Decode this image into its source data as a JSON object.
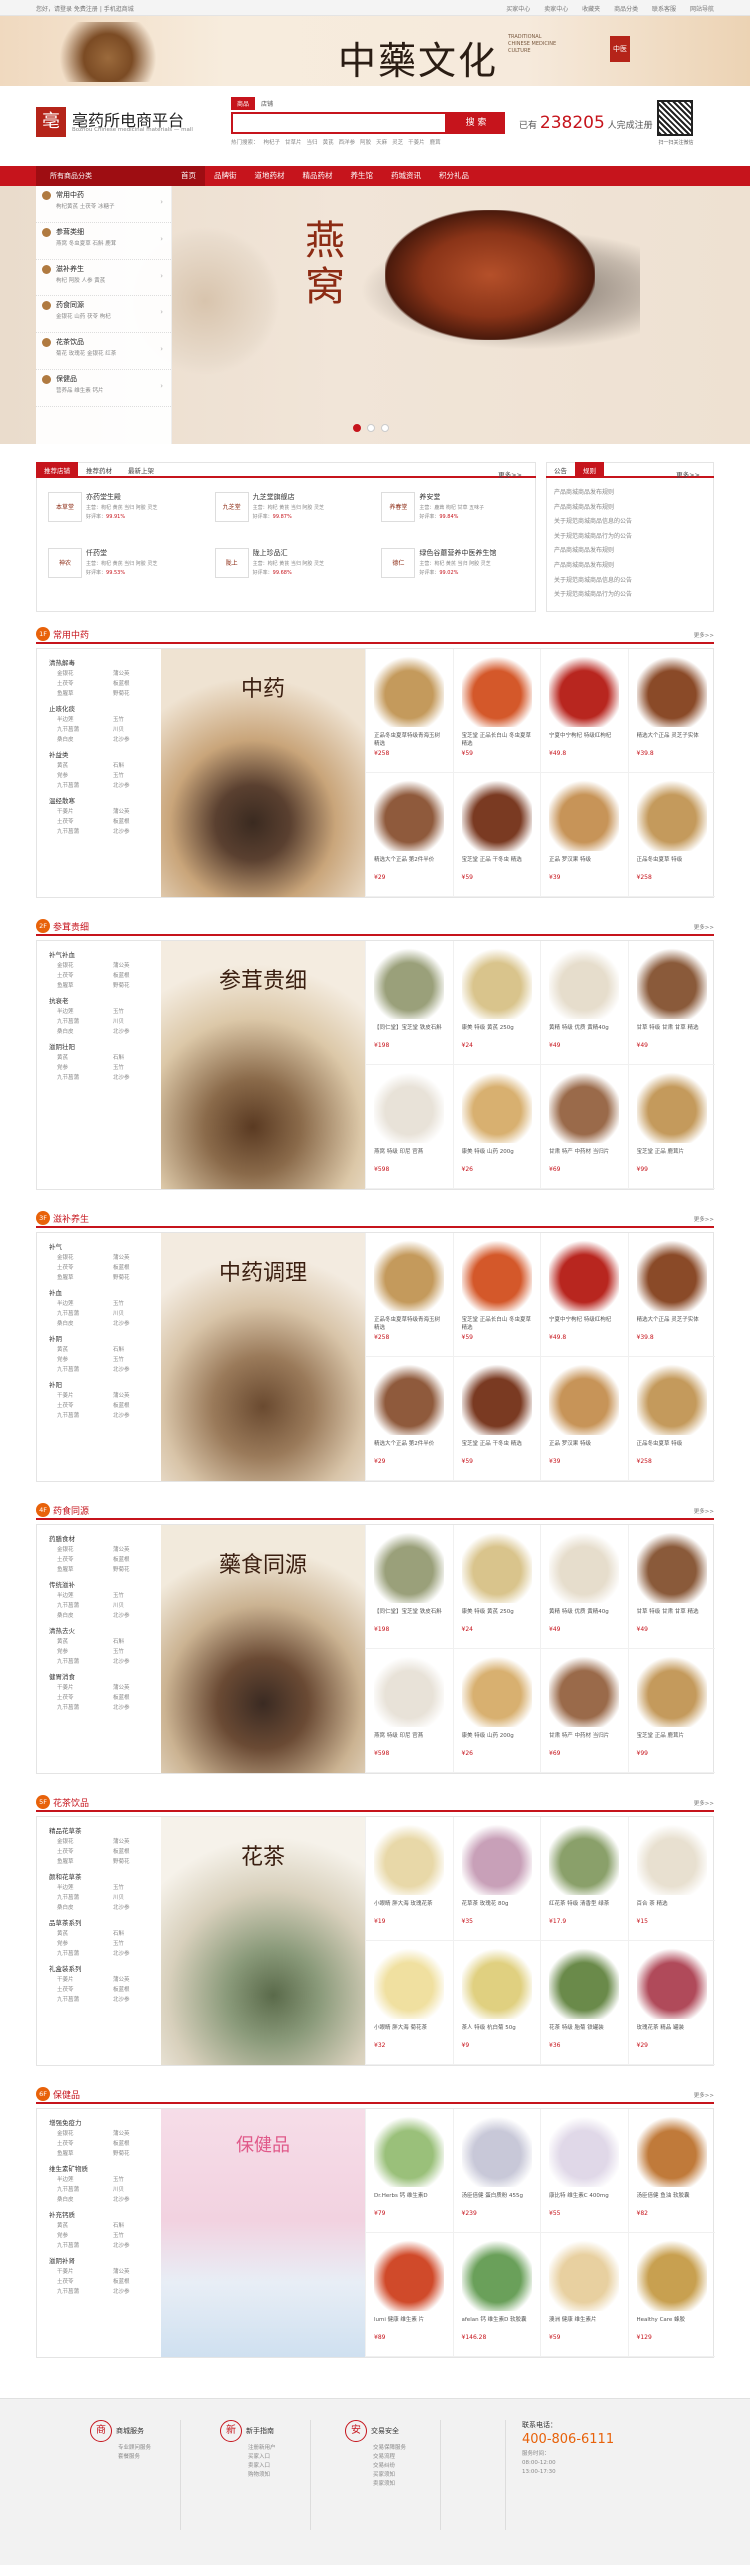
{
  "topbar": {
    "left": "您好，请登录 免费注册 | 手机逛商城",
    "links": [
      "买家中心",
      "卖家中心",
      "收藏夹",
      "商品分类",
      "联系客服",
      "网站导航"
    ]
  },
  "banner": {
    "title": "中藥文化",
    "seal": "中医",
    "sub": "TRADITIONAL CHINESE MEDICINE CULTURE"
  },
  "logo": {
    "mark": "亳",
    "name": "亳药所电商平台",
    "en": "Bozhou Chinese medicinal materials — mall"
  },
  "search": {
    "tabs": [
      "商品",
      "店铺"
    ],
    "placeholder": "",
    "button": "搜 索",
    "hot_label": "热门搜索：",
    "hot": [
      "枸杞子",
      "甘草片",
      "当归",
      "黄芪",
      "西洋参",
      "阿胶",
      "天麻",
      "灵芝",
      "干姜片",
      "鹿茸"
    ]
  },
  "joined": {
    "prefix": "已有",
    "count": "238205",
    "suffix": "人完成注册"
  },
  "qr_label": "扫一扫关注微信",
  "nav": {
    "all": "所有商品分类",
    "items": [
      "首页",
      "品牌街",
      "道地药材",
      "精品药材",
      "养生馆",
      "药城资讯",
      "积分礼品"
    ]
  },
  "categories": [
    {
      "t": "常用中药",
      "s": "枸杞黄芪  土茯苓  冰糖子"
    },
    {
      "t": "参茸类细",
      "s": "燕窝  冬虫夏草  石斛  鹿茸"
    },
    {
      "t": "滋补养生",
      "s": "枸杞  阿胶  人参  黄芪"
    },
    {
      "t": "药食同源",
      "s": "金银花  山药  茯苓  枸杞"
    },
    {
      "t": "花茶饮品",
      "s": "菊花  玫瑰花  金银花  红茶"
    },
    {
      "t": "保健品",
      "s": "营养品  维生素  钙片"
    }
  ],
  "hero": {
    "title": "燕窝"
  },
  "shops": {
    "tabs": [
      "推荐店铺",
      "推荐药材",
      "最新上架"
    ],
    "more": "更多>>",
    "items": [
      {
        "logo": "本草堂",
        "name": "亦药堂生殿",
        "desc": "主营：枸杞  黄芪  当归  阿胶 灵芝",
        "good": "99.91%"
      },
      {
        "logo": "九芝堂",
        "name": "九芝堂旗舰店",
        "desc": "主营：枸杞  黄芪  当归  阿胶 灵芝",
        "good": "99.87%"
      },
      {
        "logo": "养春堂",
        "name": "养安堂",
        "desc": "主营：鹿茸  枸杞  甘草  五味子",
        "good": "99.84%"
      },
      {
        "logo": "神农",
        "name": "仟药堂",
        "desc": "主营：枸杞  黄芪  当归  阿胶 灵芝",
        "good": "99.53%"
      },
      {
        "logo": "陇上",
        "name": "陇上珍品汇",
        "desc": "主营：枸杞  黄芪  当归  阿胶 灵芝",
        "good": "99.68%"
      },
      {
        "logo": "德仁",
        "name": "绿色谷蘑营养中医养生馆",
        "desc": "主营：枸杞  黄芪  当归  阿胶 灵芝",
        "good": "99.02%"
      }
    ],
    "good_label": "好评率："
  },
  "notice": {
    "tabs": [
      "公告",
      "规则"
    ],
    "more": "更多>>",
    "items": [
      "产品商城商品发布规则",
      "产品商城商品发布规则",
      "关于规范商城商品信息的公告",
      "关于规范商城商品行为的公告",
      "产品商城商品发布规则",
      "产品商城商品发布规则",
      "关于规范商城商品信息的公告",
      "关于规范商城商品行为的公告"
    ]
  },
  "floors": [
    {
      "num": "1F",
      "title": "常用中药",
      "more": "更多>>",
      "ad": "中药",
      "groups": [
        {
          "h": "清热解毒",
          "l": [
            "金银花",
            "蒲公英",
            "土茯苓",
            "板蓝根",
            "鱼腥草",
            "野菊花"
          ]
        },
        {
          "h": "止咳化痰",
          "l": [
            "半边莲",
            "玉竹",
            "九节菖蒲",
            "川贝",
            "桑白皮",
            "北沙参"
          ]
        },
        {
          "h": "补益类",
          "l": [
            "黄芪",
            "石斛",
            "党参",
            "玉竹",
            "九节菖蒲",
            "北沙参"
          ]
        },
        {
          "h": "温经散寒",
          "l": [
            "干姜片",
            "蒲公英",
            "土茯苓",
            "板蓝根",
            "九节菖蒲",
            "北沙参"
          ]
        }
      ],
      "prods": [
        {
          "n": "正品冬虫夏草特级青海玉树精选",
          "p": "¥258",
          "c": "#c49a5c"
        },
        {
          "n": "宝芝堂 正品长白山 冬虫夏草 精选",
          "p": "¥59",
          "c": "#d4582a"
        },
        {
          "n": "宁夏中宁枸杞 特级红枸杞",
          "p": "¥49.8",
          "c": "#b8261f"
        },
        {
          "n": "精选大个正品 灵芝子实体",
          "p": "¥39.8",
          "c": "#8a4a28"
        },
        {
          "n": "精选大个正品 第2件半价",
          "p": "¥29",
          "c": "#8f5a3c"
        },
        {
          "n": "宝芝堂 正品 干冬虫 精选",
          "p": "¥59",
          "c": "#7a3a22"
        },
        {
          "n": "正品 罗汉果 特级",
          "p": "¥39",
          "c": "#c79458"
        },
        {
          "n": "正品冬虫夏草 特级",
          "p": "¥258",
          "c": "#c49a5c"
        }
      ]
    },
    {
      "num": "2F",
      "title": "参茸贵细",
      "more": "更多>>",
      "ad": "参茸贵细",
      "groups": [
        {
          "h": "补气补血",
          "l": [
            "金银花",
            "蒲公英",
            "土茯苓",
            "板蓝根",
            "鱼腥草",
            "野菊花"
          ]
        },
        {
          "h": "抗衰老",
          "l": [
            "半边莲",
            "玉竹",
            "九节菖蒲",
            "川贝",
            "桑白皮",
            "北沙参"
          ]
        },
        {
          "h": "滋阴壮阳",
          "l": [
            "黄芪",
            "石斛",
            "党参",
            "玉竹",
            "九节菖蒲",
            "北沙参"
          ]
        }
      ],
      "prods": [
        {
          "n": "【同仁堂】宝芝堂 铁皮石斛",
          "p": "¥198",
          "c": "#9aa07a"
        },
        {
          "n": "康美 特级 黄芪 250g",
          "p": "¥24",
          "c": "#d9c48c"
        },
        {
          "n": "黄精 特级 优质 黄精40g",
          "p": "¥49",
          "c": "#e6ddcc"
        },
        {
          "n": "甘草 特级 甘肃 甘草 精选",
          "p": "¥49",
          "c": "#8a5a3a"
        },
        {
          "n": "燕窝 特级 印尼 官燕",
          "p": "¥598",
          "c": "#e8e2d8"
        },
        {
          "n": "康美 特级 山药 200g",
          "p": "¥26",
          "c": "#d8b070"
        },
        {
          "n": "甘肃 特产 中药材 当归片",
          "p": "¥69",
          "c": "#9a6a4a"
        },
        {
          "n": "宝芝堂 正品 鹿茸片",
          "p": "¥99",
          "c": "#c49a5c"
        }
      ]
    },
    {
      "num": "3F",
      "title": "滋补养生",
      "more": "更多>>",
      "ad": "中药调理",
      "groups": [
        {
          "h": "补气",
          "l": [
            "金银花",
            "蒲公英",
            "土茯苓",
            "板蓝根",
            "鱼腥草",
            "野菊花"
          ]
        },
        {
          "h": "补血",
          "l": [
            "半边莲",
            "玉竹",
            "九节菖蒲",
            "川贝",
            "桑白皮",
            "北沙参"
          ]
        },
        {
          "h": "补阴",
          "l": [
            "黄芪",
            "石斛",
            "党参",
            "玉竹",
            "九节菖蒲",
            "北沙参"
          ]
        },
        {
          "h": "补阳",
          "l": [
            "干姜片",
            "蒲公英",
            "土茯苓",
            "板蓝根",
            "九节菖蒲",
            "北沙参"
          ]
        }
      ],
      "prods": [
        {
          "n": "正品冬虫夏草特级青海玉树精选",
          "p": "¥258",
          "c": "#c49a5c"
        },
        {
          "n": "宝芝堂 正品长白山 冬虫夏草 精选",
          "p": "¥59",
          "c": "#d4582a"
        },
        {
          "n": "宁夏中宁枸杞 特级红枸杞",
          "p": "¥49.8",
          "c": "#b8261f"
        },
        {
          "n": "精选大个正品 灵芝子实体",
          "p": "¥39.8",
          "c": "#8a4a28"
        },
        {
          "n": "精选大个正品 第2件半价",
          "p": "¥29",
          "c": "#8f5a3c"
        },
        {
          "n": "宝芝堂 正品 干冬虫 精选",
          "p": "¥59",
          "c": "#7a3a22"
        },
        {
          "n": "正品 罗汉果 特级",
          "p": "¥39",
          "c": "#c79458"
        },
        {
          "n": "正品冬虫夏草 特级",
          "p": "¥258",
          "c": "#c49a5c"
        }
      ]
    },
    {
      "num": "4F",
      "title": "药食同源",
      "more": "更多>>",
      "ad": "藥食同源",
      "groups": [
        {
          "h": "药膳食材",
          "l": [
            "金银花",
            "蒲公英",
            "土茯苓",
            "板蓝根",
            "鱼腥草",
            "野菊花"
          ]
        },
        {
          "h": "传统滋补",
          "l": [
            "半边莲",
            "玉竹",
            "九节菖蒲",
            "川贝",
            "桑白皮",
            "北沙参"
          ]
        },
        {
          "h": "清热去火",
          "l": [
            "黄芪",
            "石斛",
            "党参",
            "玉竹",
            "九节菖蒲",
            "北沙参"
          ]
        },
        {
          "h": "健胃消食",
          "l": [
            "干姜片",
            "蒲公英",
            "土茯苓",
            "板蓝根",
            "九节菖蒲",
            "北沙参"
          ]
        }
      ],
      "prods": [
        {
          "n": "【同仁堂】宝芝堂 铁皮石斛",
          "p": "¥198",
          "c": "#9aa07a"
        },
        {
          "n": "康美 特级 黄芪 250g",
          "p": "¥24",
          "c": "#d9c48c"
        },
        {
          "n": "黄精 特级 优质 黄精40g",
          "p": "¥49",
          "c": "#e6ddcc"
        },
        {
          "n": "甘草 特级 甘肃 甘草 精选",
          "p": "¥49",
          "c": "#8a5a3a"
        },
        {
          "n": "燕窝 特级 印尼 官燕",
          "p": "¥598",
          "c": "#e8e2d8"
        },
        {
          "n": "康美 特级 山药 200g",
          "p": "¥26",
          "c": "#d8b070"
        },
        {
          "n": "甘肃 特产 中药材 当归片",
          "p": "¥69",
          "c": "#9a6a4a"
        },
        {
          "n": "宝芝堂 正品 鹿茸片",
          "p": "¥99",
          "c": "#c49a5c"
        }
      ]
    },
    {
      "num": "5F",
      "title": "花茶饮品",
      "more": "更多>>",
      "ad": "花茶",
      "groups": [
        {
          "h": "精品花草茶",
          "l": [
            "金银花",
            "蒲公英",
            "土茯苓",
            "板蓝根",
            "鱼腥草",
            "野菊花"
          ]
        },
        {
          "h": "颜和花草茶",
          "l": [
            "半边莲",
            "玉竹",
            "九节菖蒲",
            "川贝",
            "桑白皮",
            "北沙参"
          ]
        },
        {
          "h": "品草茶系列",
          "l": [
            "黄芪",
            "石斛",
            "党参",
            "玉竹",
            "九节菖蒲",
            "北沙参"
          ]
        },
        {
          "h": "礼盒装系列",
          "l": [
            "干姜片",
            "蒲公英",
            "土茯苓",
            "板蓝根",
            "九节菖蒲",
            "北沙参"
          ]
        }
      ],
      "prods": [
        {
          "n": "小眼睛 胖大海 玫瑰花茶",
          "p": "¥19",
          "c": "#e8d8a8"
        },
        {
          "n": "花草茶 玫瑰花 80g",
          "p": "¥35",
          "c": "#c8a0b8"
        },
        {
          "n": "红花茶 特级 清香型 绿茶",
          "p": "¥17.9",
          "c": "#8aa06a"
        },
        {
          "n": "百合 茶 精选",
          "p": "¥15",
          "c": "#e8e0d0"
        },
        {
          "n": "小眼睛 胖大海 菊花茶",
          "p": "¥32",
          "c": "#f0e0a0"
        },
        {
          "n": "茶人 特级 杭白菊 50g",
          "p": "¥9",
          "c": "#e0d080"
        },
        {
          "n": "花茶 特级 胎菊 铁罐装",
          "p": "¥36",
          "c": "#6a8a4a"
        },
        {
          "n": "玫瑰花茶 精品 罐装",
          "p": "¥29",
          "c": "#b04a5a"
        }
      ]
    },
    {
      "num": "6F",
      "title": "保健品",
      "more": "更多>>",
      "ad": "保健品",
      "groups": [
        {
          "h": "增强免疫力",
          "l": [
            "金银花",
            "蒲公英",
            "土茯苓",
            "板蓝根",
            "鱼腥草",
            "野菊花"
          ]
        },
        {
          "h": "维生素矿物质",
          "l": [
            "半边莲",
            "玉竹",
            "九节菖蒲",
            "川贝",
            "桑白皮",
            "北沙参"
          ]
        },
        {
          "h": "补充钙质",
          "l": [
            "黄芪",
            "石斛",
            "党参",
            "玉竹",
            "九节菖蒲",
            "北沙参"
          ]
        },
        {
          "h": "滋阴补肾",
          "l": [
            "干姜片",
            "蒲公英",
            "土茯苓",
            "板蓝根",
            "九节菖蒲",
            "北沙参"
          ]
        }
      ],
      "prods": [
        {
          "n": "Dr.Herbs 钙 维生素D",
          "p": "¥79",
          "c": "#9ac07a"
        },
        {
          "n": "汤臣倍健 蛋白质粉 455g",
          "p": "¥239",
          "c": "#c8c8d8"
        },
        {
          "n": "康比特 维生素C 400mg",
          "p": "¥55",
          "c": "#e0d8e8"
        },
        {
          "n": "汤臣倍健 鱼油 软胶囊",
          "p": "¥82",
          "c": "#c07a3a"
        },
        {
          "n": "lumi 健康 维生素 片",
          "p": "¥89",
          "c": "#d04a2a"
        },
        {
          "n": "afelan 钙 维生素D 软胶囊",
          "p": "¥146.28",
          "c": "#6aa05a"
        },
        {
          "n": "澳洲 健康 维生素片",
          "p": "¥59",
          "c": "#e8d0a0"
        },
        {
          "n": "Healthy Care 蜂胶",
          "p": "¥129",
          "c": "#c8a050"
        }
      ]
    }
  ],
  "footer": {
    "cols": [
      {
        "icon": "商",
        "h": "商城服务",
        "l": [
          "专业顾问服务",
          "套餐服务"
        ]
      },
      {
        "icon": "新",
        "h": "新手指南",
        "l": [
          "注册新用户",
          "买家入口",
          "卖家入口",
          "购物须知"
        ]
      },
      {
        "icon": "安",
        "h": "交易安全",
        "l": [
          "交易保障服务",
          "交易流程",
          "交易纠纷",
          "买家须知",
          "卖家须知"
        ]
      }
    ],
    "phone_label": "联系电话：",
    "phone": "400-806-6111",
    "svc": [
      "服务时间：",
      "08:00-12:00",
      "13:00-17:30"
    ]
  }
}
